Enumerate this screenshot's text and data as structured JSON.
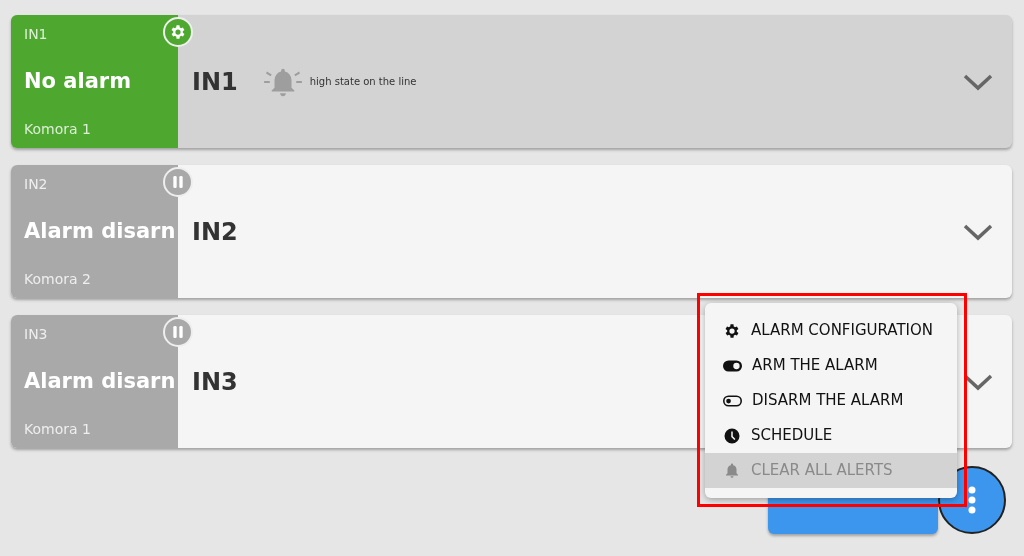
{
  "inputs": [
    {
      "code": "IN1",
      "status": "No alarm",
      "kind": "ok",
      "zone": "Komora 1",
      "name": "IN1",
      "selected": true,
      "alert": "high state on the line"
    },
    {
      "code": "IN2",
      "status": "Alarm disarn",
      "kind": "disarmed",
      "zone": "Komora 2",
      "name": "IN2",
      "selected": false
    },
    {
      "code": "IN3",
      "status": "Alarm disarn",
      "kind": "disarmed",
      "zone": "Komora 1",
      "name": "IN3",
      "selected": false
    }
  ],
  "menu": {
    "items": [
      {
        "label": "ALARM CONFIGURATION",
        "kind": "config",
        "selected": false,
        "disabled": false
      },
      {
        "label": "ARM THE ALARM",
        "kind": "arm",
        "selected": false,
        "disabled": false
      },
      {
        "label": "DISARM THE ALARM",
        "kind": "disarm",
        "selected": false,
        "disabled": false
      },
      {
        "label": "SCHEDULE",
        "kind": "schedule",
        "selected": false,
        "disabled": false
      },
      {
        "label": "CLEAR ALL ALERTS",
        "kind": "clear",
        "selected": true,
        "disabled": true
      }
    ]
  }
}
